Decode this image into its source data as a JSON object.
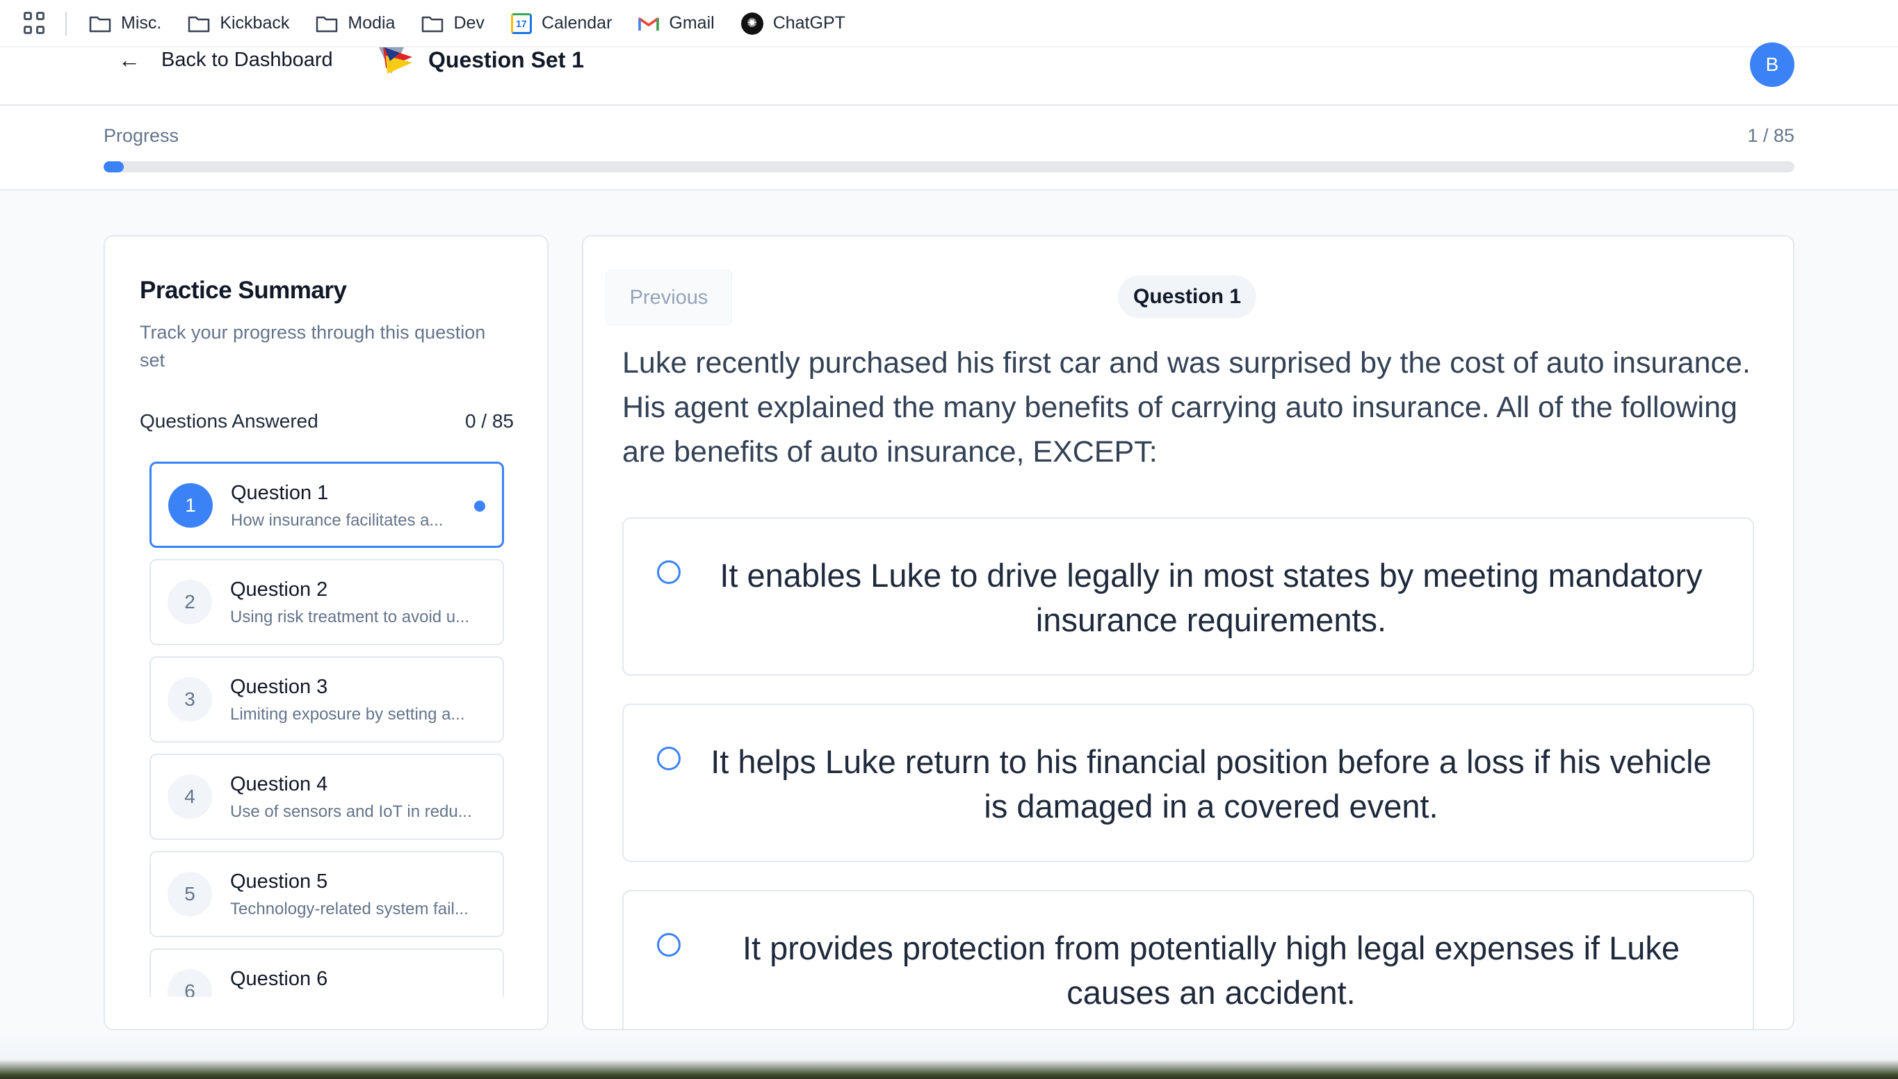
{
  "bookmarks": {
    "items": [
      {
        "label": "Misc.",
        "icon": "folder-icon"
      },
      {
        "label": "Kickback",
        "icon": "folder-icon"
      },
      {
        "label": "Modia",
        "icon": "folder-icon"
      },
      {
        "label": "Dev",
        "icon": "folder-icon"
      },
      {
        "label": "Calendar",
        "icon": "calendar-icon"
      },
      {
        "label": "Gmail",
        "icon": "gmail-icon"
      },
      {
        "label": "ChatGPT",
        "icon": "chatgpt-icon"
      }
    ],
    "calendar_day": "17"
  },
  "header": {
    "back_label": "Back to Dashboard",
    "set_title": "Question Set 1",
    "avatar_initial": "B"
  },
  "progress": {
    "label": "Progress",
    "count_text": "1 / 85",
    "current": 1,
    "total": 85
  },
  "summary": {
    "title": "Practice Summary",
    "subtitle": "Track your progress through this question set",
    "answered_label": "Questions Answered",
    "answered_count": "0 / 85",
    "questions": [
      {
        "number": "1",
        "title": "Question 1",
        "desc": "How insurance facilitates a...",
        "active": true
      },
      {
        "number": "2",
        "title": "Question 2",
        "desc": "Using risk treatment to avoid u...",
        "active": false
      },
      {
        "number": "3",
        "title": "Question 3",
        "desc": "Limiting exposure by setting a...",
        "active": false
      },
      {
        "number": "4",
        "title": "Question 4",
        "desc": "Use of sensors and IoT in redu...",
        "active": false
      },
      {
        "number": "5",
        "title": "Question 5",
        "desc": "Technology-related system fail...",
        "active": false
      },
      {
        "number": "6",
        "title": "Question 6",
        "desc": "",
        "active": false
      }
    ]
  },
  "question": {
    "previous_label": "Previous",
    "badge": "Question 1",
    "text": "Luke recently purchased his first car and was surprised by the cost of auto insurance. His agent explained the many benefits of carrying auto insurance. All of the following are benefits of auto insurance, EXCEPT:",
    "options": [
      "It enables Luke to drive legally in most states by meeting mandatory insurance requirements.",
      "It helps Luke return to his financial position before a loss if his vehicle is damaged in a covered event.",
      "It provides protection from potentially high legal expenses if Luke causes an accident."
    ]
  },
  "colors": {
    "accent": "#3b82f6",
    "border": "#e2e8f0",
    "muted_text": "#64748b"
  }
}
